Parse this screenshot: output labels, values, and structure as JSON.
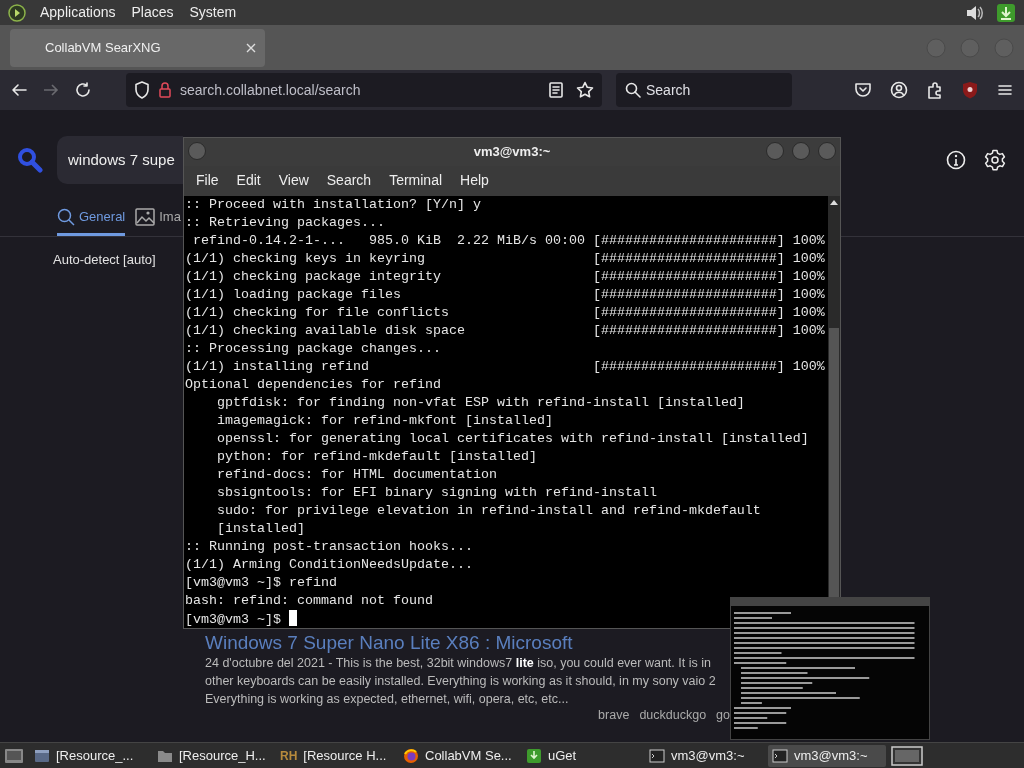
{
  "top_panel": {
    "menus": [
      "Applications",
      "Places",
      "System"
    ]
  },
  "browser": {
    "tabs": [
      {
        "label": "CollabVM SearXNG",
        "selected": true
      }
    ],
    "toolbar": {
      "forward_disabled": true,
      "url": "search.collabnet.local/search",
      "search_placeholder": "Search"
    },
    "page": {
      "query": "windows 7 supe",
      "categories": [
        {
          "label": "General",
          "selected": true,
          "kind": "general"
        },
        {
          "label": "Ima",
          "selected": false,
          "kind": "images"
        }
      ],
      "language": "Auto-detect [auto]",
      "result": {
        "title": "Windows 7 Super Nano Lite X86 : Microsoft",
        "snippet_lines": [
          "24 d'octubre del 2021 - This is the best, 32bit windows7 **lite** iso, you could ever want. It is in",
          "other keyboards can be easily installed. Everything is working as it should, in my sony vaio 2",
          "Everything is working as expected, ethernet, wifi, opera, etc, etc..."
        ],
        "engines": [
          "brave",
          "duckduckgo",
          "go"
        ]
      }
    }
  },
  "terminal": {
    "title": "vm3@vm3:~",
    "menus": [
      "File",
      "Edit",
      "View",
      "Search",
      "Terminal",
      "Help"
    ],
    "lines": [
      ":: Proceed with installation? [Y/n] y",
      ":: Retrieving packages...",
      " refind-0.14.2-1-...   985.0 KiB  2.22 MiB/s 00:00 [######################] 100%",
      "(1/1) checking keys in keyring                     [######################] 100%",
      "(1/1) checking package integrity                   [######################] 100%",
      "(1/1) loading package files                        [######################] 100%",
      "(1/1) checking for file conflicts                  [######################] 100%",
      "(1/1) checking available disk space                [######################] 100%",
      ":: Processing package changes...",
      "(1/1) installing refind                            [######################] 100%",
      "Optional dependencies for refind",
      "    gptfdisk: for finding non-vfat ESP with refind-install [installed]",
      "    imagemagick: for refind-mkfont [installed]",
      "    openssl: for generating local certificates with refind-install [installed]",
      "    python: for refind-mkdefault [installed]",
      "    refind-docs: for HTML documentation",
      "    sbsigntools: for EFI binary signing with refind-install",
      "    sudo: for privilege elevation in refind-install and refind-mkdefault",
      "    [installed]",
      ":: Running post-transaction hooks...",
      "(1/1) Arming ConditionNeedsUpdate...",
      "[vm3@vm3 ~]$ refind",
      "bash: refind: command not found",
      "[vm3@vm3 ~]$ "
    ]
  },
  "taskbar": {
    "items": [
      {
        "kind": "window",
        "label": "[Resource_...",
        "selected": false
      },
      {
        "kind": "folder",
        "label": "[Resource_H...",
        "selected": false
      },
      {
        "kind": "rh",
        "badge": "RH",
        "label": "[Resource H...",
        "selected": false
      },
      {
        "kind": "firefox",
        "label": "CollabVM Se...",
        "selected": false
      },
      {
        "kind": "uget",
        "label": "uGet",
        "selected": false
      },
      {
        "kind": "terminal",
        "label": "vm3@vm3:~",
        "selected": false
      },
      {
        "kind": "terminal",
        "label": "vm3@vm3:~",
        "selected": true
      }
    ]
  }
}
